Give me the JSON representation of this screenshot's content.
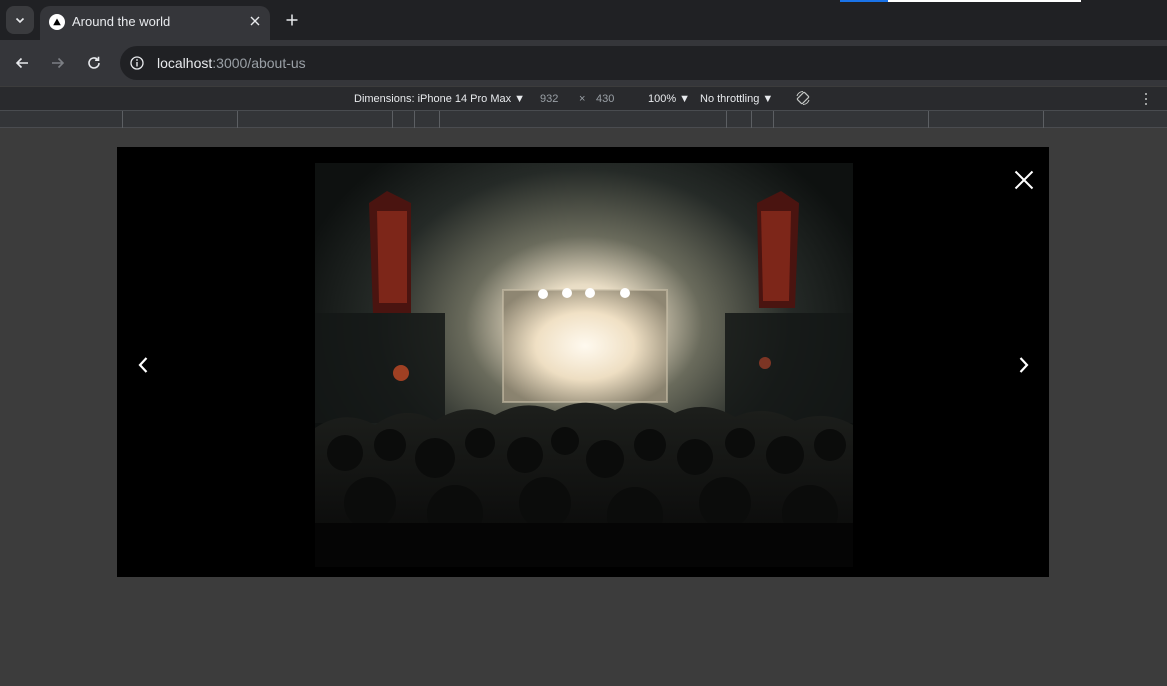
{
  "browser": {
    "tab": {
      "title": "Around the world",
      "favicon": "triangle-icon"
    },
    "url": {
      "host": "localhost",
      "path": ":3000/about-us"
    }
  },
  "devtools": {
    "device_label": "Dimensions: iPhone 14 Pro Max",
    "width": "932",
    "times": "×",
    "height": "430",
    "zoom": "100%",
    "throttling": "No throttling"
  },
  "lightbox": {
    "image_alt": "Concert crowd facing a brightly lit stage in a dark theater",
    "icons": {
      "close": "close-icon",
      "prev": "chevron-left-icon",
      "next": "chevron-right-icon"
    }
  },
  "colors": {
    "tab_strip": "#202124",
    "toolbar": "#35363a",
    "page_background": "#3c3c3c",
    "lightbox_background": "#000000"
  }
}
